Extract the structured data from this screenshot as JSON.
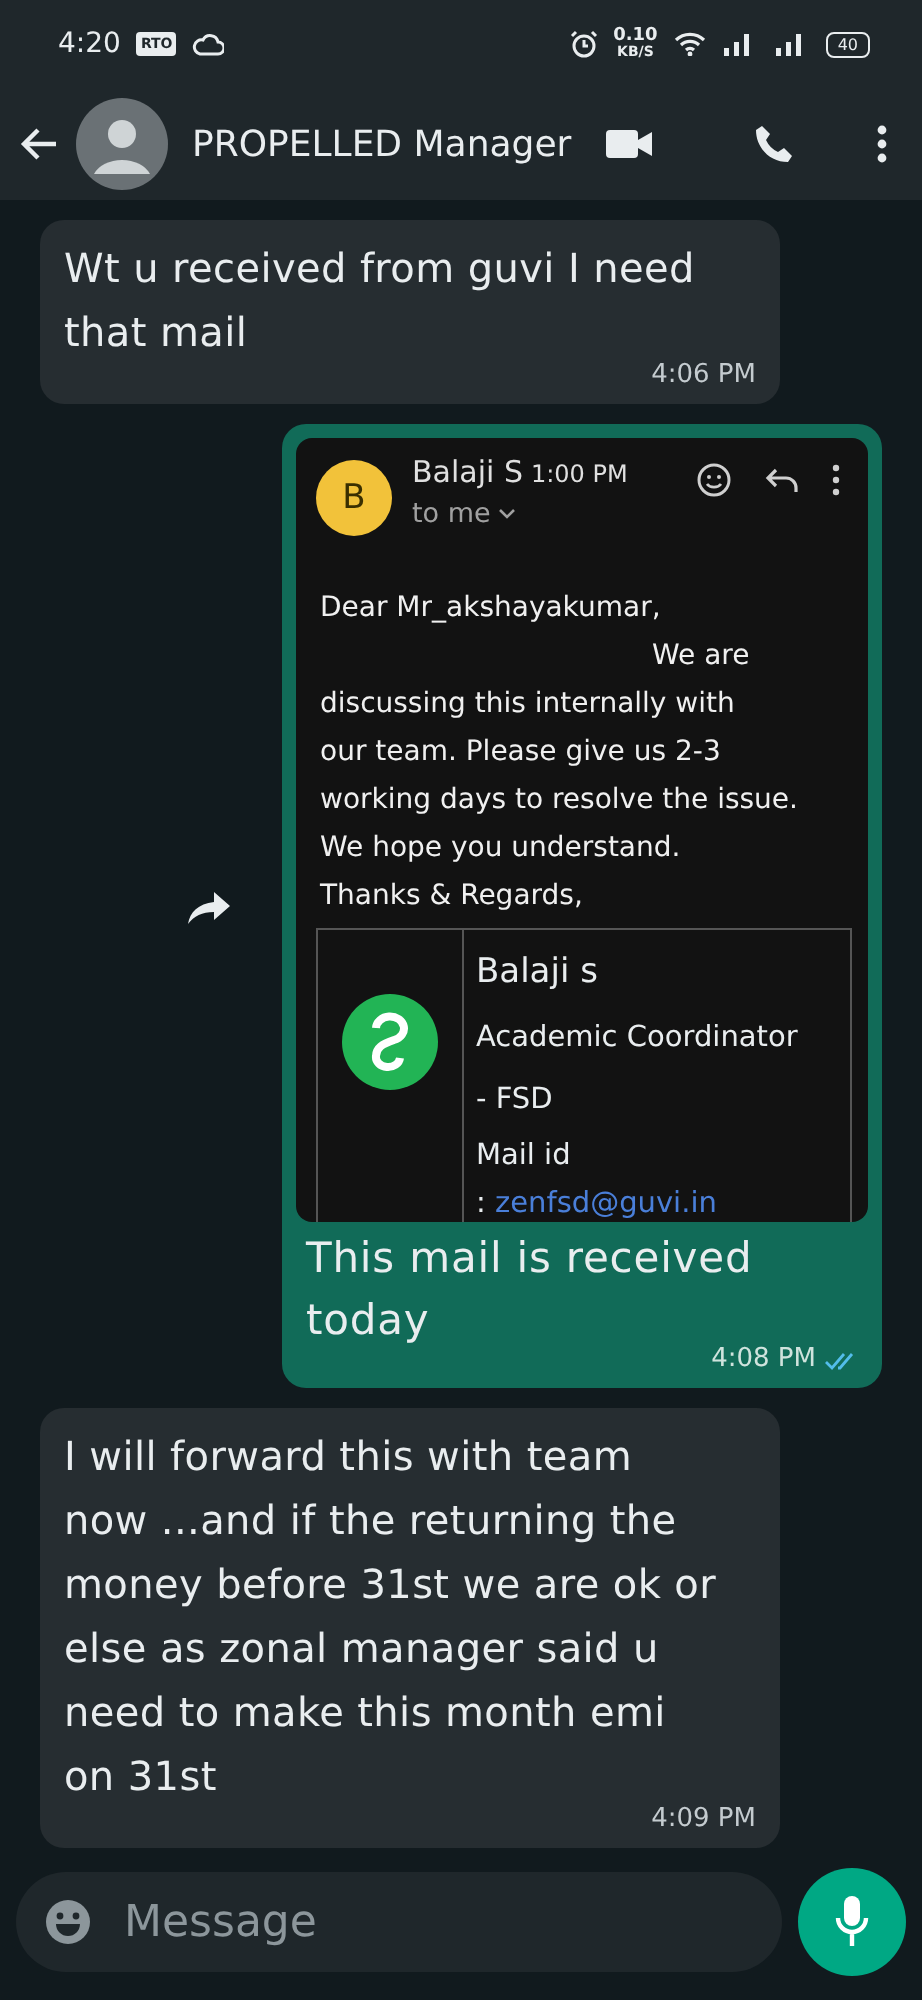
{
  "status_bar": {
    "time": "4:20",
    "badge": "RTO",
    "speed": "0.10",
    "speed_unit": "KB/S",
    "battery": "40"
  },
  "header": {
    "title": "PROPELLED Manager"
  },
  "messages": [
    {
      "kind": "text",
      "outgoing": false,
      "text": "Wt u received from guvi I need that mail",
      "time": "4:06 PM"
    },
    {
      "kind": "image",
      "outgoing": true,
      "email": {
        "avatar": "B",
        "sender": "Balaji S",
        "sent_time": "1:00 PM",
        "recipient": "to me",
        "greeting": "Dear Mr_akshayakumar,",
        "lead": "We are",
        "body_lines": [
          "discussing this internally with",
          "our team. Please give us 2-3",
          "working days to resolve the issue.",
          "We hope you understand."
        ],
        "closing": "Thanks & Regards,",
        "signature": {
          "name": "Balaji s",
          "role": "Academic Coordinator",
          "dept": "- FSD",
          "mail_label": "Mail id",
          "mail_sep": ":",
          "mail": "zenfsd@guvi.in"
        }
      },
      "caption": "This mail is received today",
      "time": "4:08 PM",
      "read": true
    },
    {
      "kind": "text",
      "outgoing": false,
      "text": "I will forward this with team now ...and if the returning the money before 31st we are ok or else as zonal manager said u need to make this month emi on 31st",
      "time": "4:09 PM"
    }
  ],
  "input": {
    "placeholder": "Message"
  }
}
